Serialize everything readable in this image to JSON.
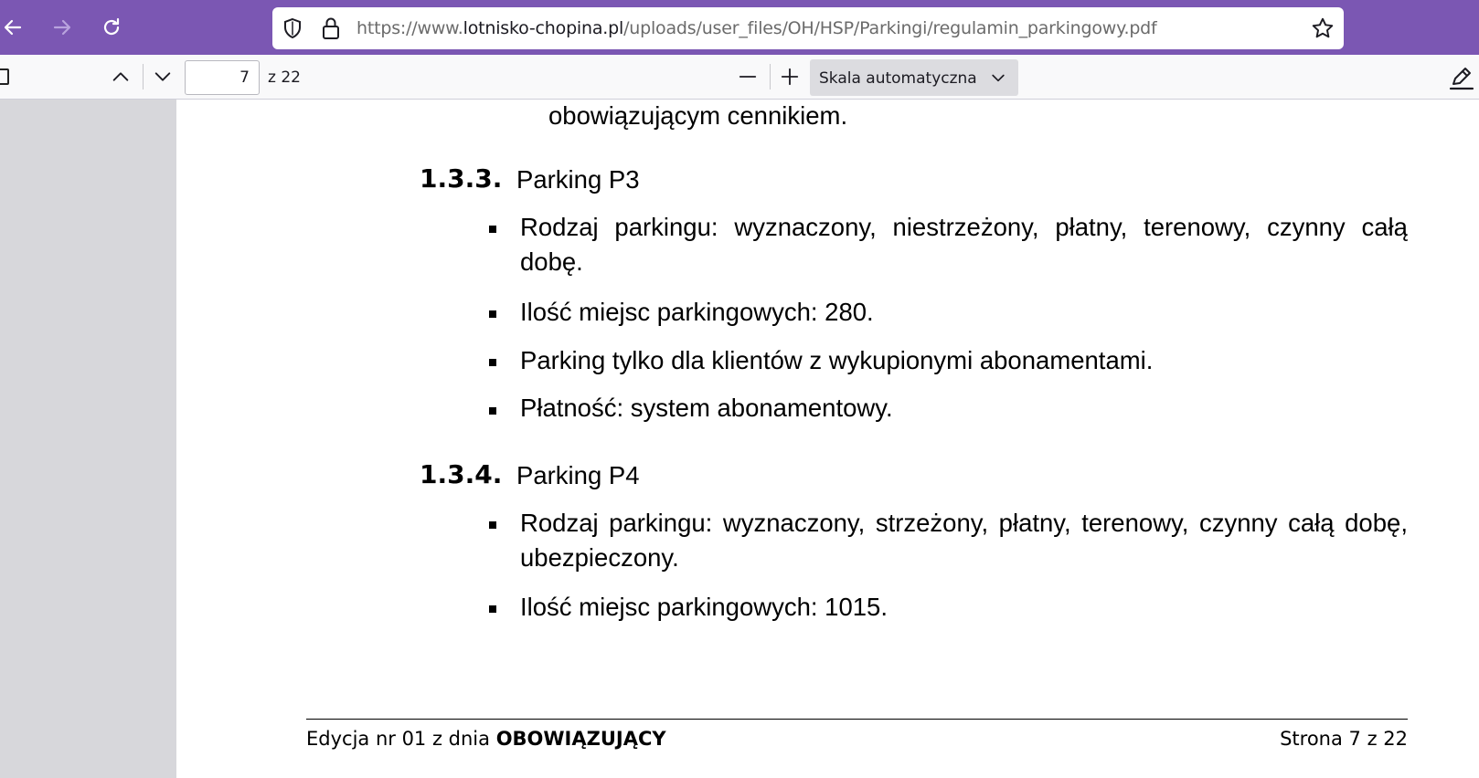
{
  "browser": {
    "url_prefix": "https://www.",
    "url_domain": "lotnisko-chopina.pl",
    "url_path": "/uploads/user_files/OH/HSP/Parkingi/regulamin_parkingowy.pdf"
  },
  "pdf_toolbar": {
    "current_page": "7",
    "page_count": "z 22",
    "zoom_label": "Skala automatyczna"
  },
  "document": {
    "carry_line": "obowiązującym cennikiem.",
    "sections": [
      {
        "number": "1.3.3.",
        "title": "Parking P3",
        "bullets": [
          {
            "line1_words": [
              "Rodzaj",
              "parkingu:",
              "wyznaczony,",
              "niestrzeżony,",
              "płatny,",
              "terenowy,",
              "czynny",
              "całą"
            ],
            "line2": "dobę."
          },
          {
            "text": "Ilość miejsc parkingowych: 280."
          },
          {
            "text": "Parking tylko dla klientów z wykupionymi abonamentami."
          },
          {
            "text": "Płatność: system abonamentowy."
          }
        ]
      },
      {
        "number": "1.3.4.",
        "title": "Parking P4",
        "bullets": [
          {
            "line1_words": [
              "Rodzaj",
              "parkingu:",
              "wyznaczony,",
              "strzeżony,",
              "płatny,",
              "terenowy,",
              "czynny",
              "całą",
              "dobę,"
            ],
            "line2": "ubezpieczony."
          },
          {
            "text": "Ilość miejsc parkingowych: 1015."
          }
        ]
      }
    ],
    "footer": {
      "left_prefix": "Edycja nr 01 z dnia ",
      "left_bold": "OBOWIĄZUJĄCY",
      "right": "Strona 7 z 22"
    }
  }
}
